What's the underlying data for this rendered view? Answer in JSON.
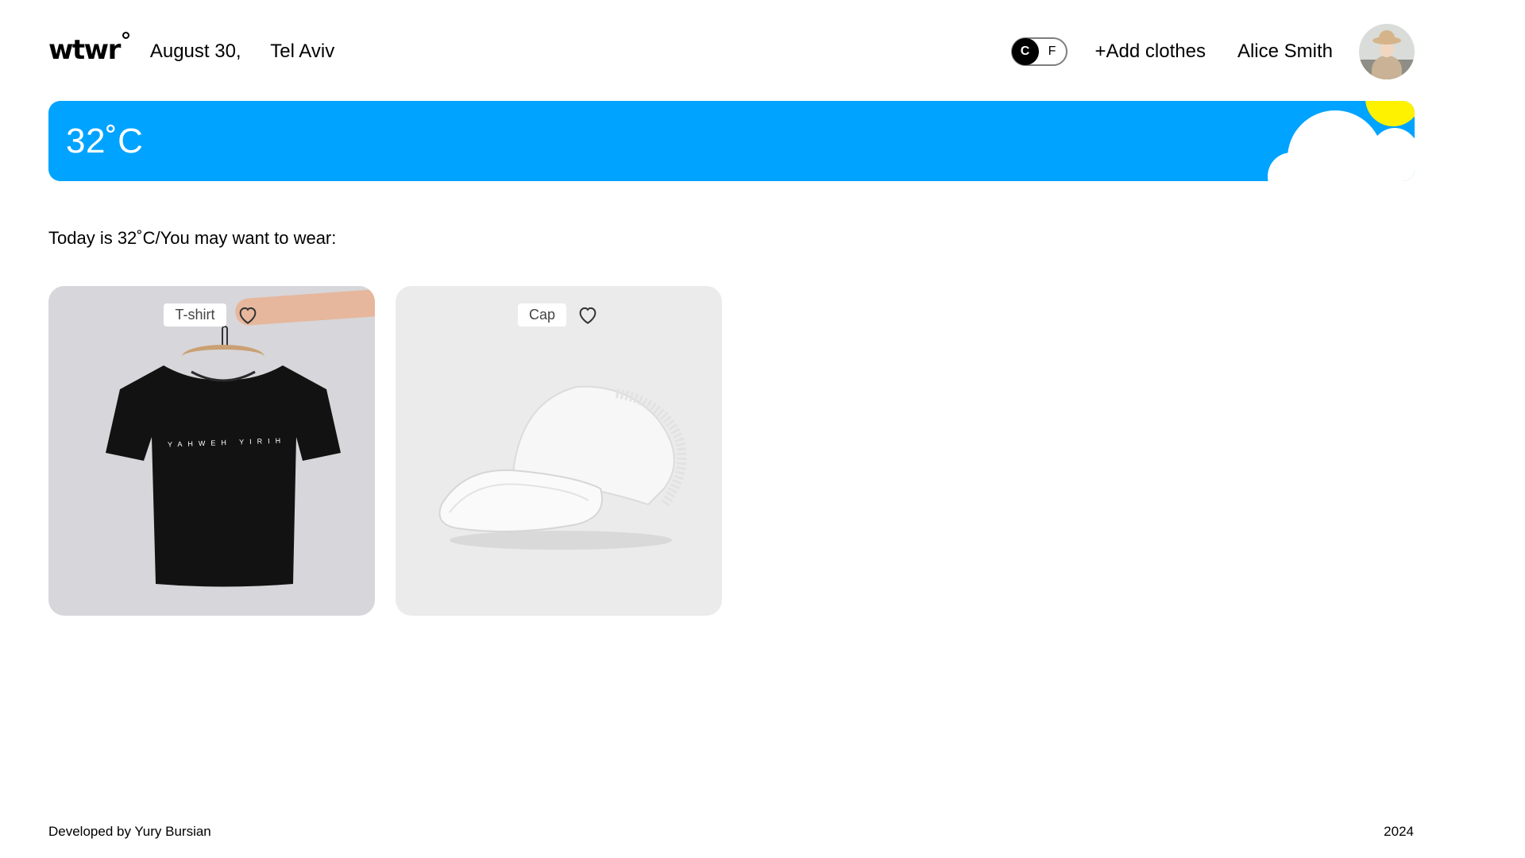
{
  "header": {
    "logo": "wtwr",
    "date": "August 30,",
    "location": "Tel Aviv",
    "unit_toggle": {
      "active": "C",
      "c_label": "C",
      "f_label": "F"
    },
    "add_clothes_label": "+Add clothes",
    "user_name": "Alice Smith"
  },
  "weather": {
    "temperature": "32˚C",
    "condition_icon": "sun-behind-cloud-icon",
    "banner_color": "#00a3ff",
    "sun_color": "#fff200"
  },
  "main": {
    "today_text": "Today is 32˚C/You may want to wear:",
    "items": [
      {
        "name": "T-shirt",
        "image": "black-tshirt-on-hanger",
        "liked": false,
        "print_text": "YAHWEH YIRIH"
      },
      {
        "name": "Cap",
        "image": "white-trucker-cap",
        "liked": false
      }
    ]
  },
  "footer": {
    "credit": "Developed by Yury Bursian",
    "year": "2024"
  }
}
